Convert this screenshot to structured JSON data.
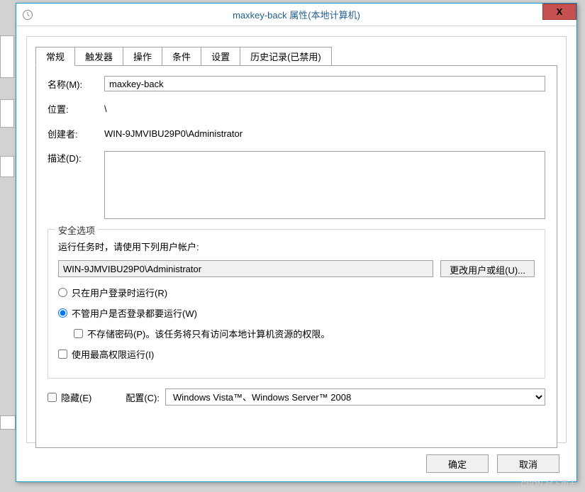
{
  "window": {
    "title": "maxkey-back 属性(本地计算机)",
    "close": "X"
  },
  "tabs": {
    "t0": "常规",
    "t1": "触发器",
    "t2": "操作",
    "t3": "条件",
    "t4": "设置",
    "t5": "历史记录(已禁用)"
  },
  "labels": {
    "name": "名称(M):",
    "location": "位置:",
    "creator": "创建者:",
    "description": "描述(D):"
  },
  "values": {
    "name": "maxkey-back",
    "location": "\\",
    "creator": "WIN-9JMVIBU29P0\\Administrator"
  },
  "security": {
    "legend": "安全选项",
    "runas_label": "运行任务时，请使用下列用户帐户:",
    "account": "WIN-9JMVIBU29P0\\Administrator",
    "change_btn": "更改用户或组(U)...",
    "radio_logged_on": "只在用户登录时运行(R)",
    "radio_any_time": "不管用户是否登录都要运行(W)",
    "nosave_pwd": "不存储密码(P)。该任务将只有访问本地计算机资源的权限。",
    "highest_priv": "使用最高权限运行(I)"
  },
  "bottom": {
    "hidden": "隐藏(E)",
    "conf_lbl": "配置(C):",
    "conf_value": "Windows Vista™、Windows Server™ 2008"
  },
  "footer": {
    "ok": "确定",
    "cancel": "取消"
  },
  "watermark": "CSDN @下雨天u"
}
